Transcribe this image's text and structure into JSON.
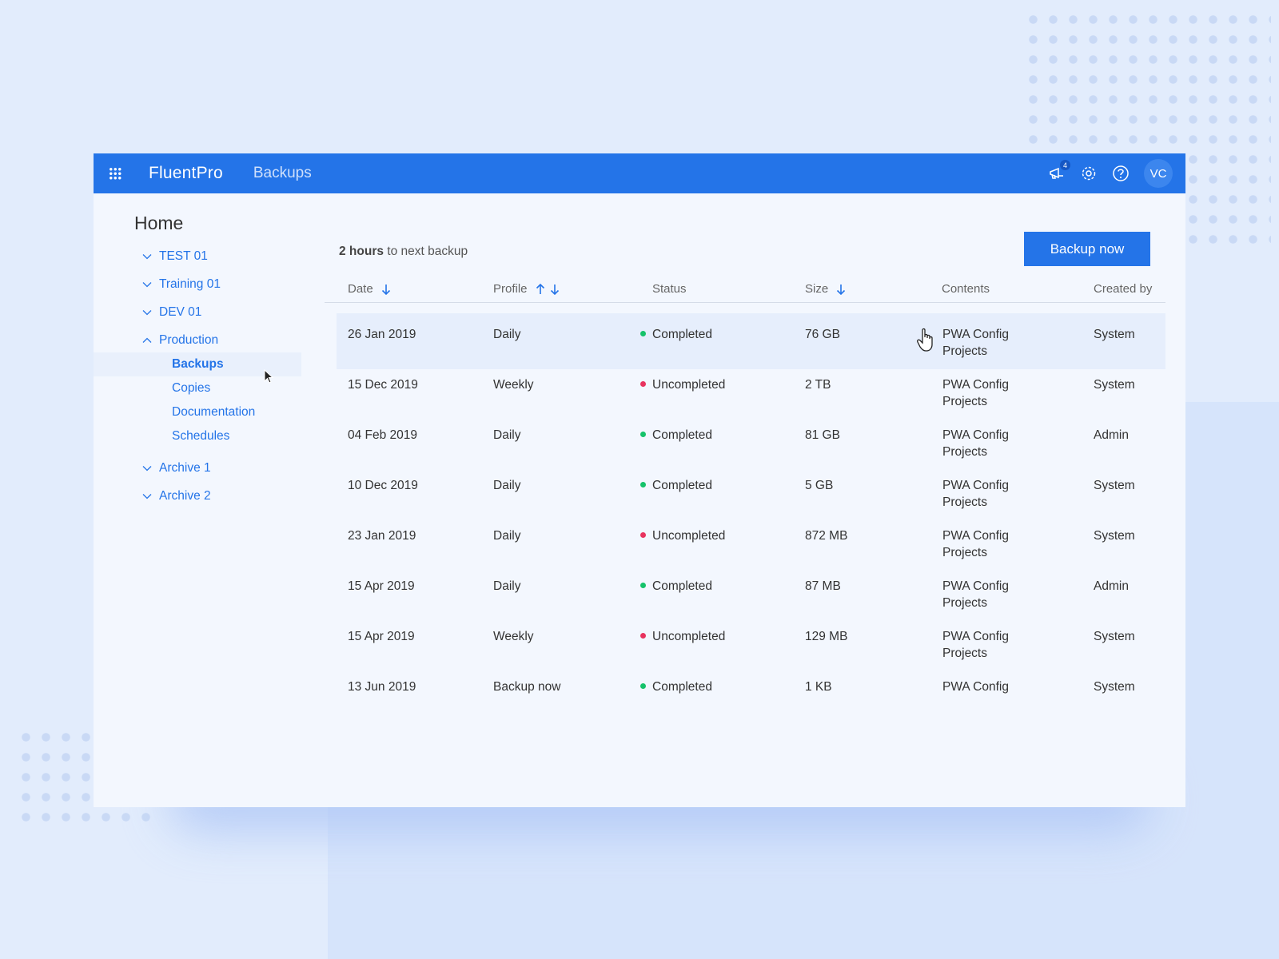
{
  "app": {
    "brand": "FluentPro",
    "section": "Backups"
  },
  "header": {
    "notifications_count": "4",
    "avatar_initials": "VC",
    "icons": [
      "grid-icon",
      "megaphone-icon",
      "gear-icon",
      "help-icon"
    ]
  },
  "sidebar": {
    "home": "Home",
    "items": [
      {
        "label": "TEST 01",
        "expanded": false
      },
      {
        "label": "Training 01",
        "expanded": false
      },
      {
        "label": "DEV 01",
        "expanded": false
      },
      {
        "label": "Production",
        "expanded": true
      }
    ],
    "sub_items": [
      {
        "label": "Backups",
        "active": true
      },
      {
        "label": "Copies"
      },
      {
        "label": "Documentation"
      },
      {
        "label": "Schedules"
      }
    ],
    "items_after": [
      {
        "label": "Archive 1"
      },
      {
        "label": "Archive 2"
      }
    ]
  },
  "main": {
    "next_backup_bold": "2 hours",
    "next_backup_rest": " to next backup",
    "backup_button": "Backup now",
    "columns": {
      "date": "Date",
      "profile": "Profile",
      "status": "Status",
      "size": "Size",
      "contents": "Contents",
      "created_by": "Created by"
    },
    "rows": [
      {
        "date": "26 Jan 2019",
        "profile": "Daily",
        "status": "Completed",
        "ok": true,
        "size": "76 GB",
        "contents": "PWA Config Projects",
        "created_by": "System"
      },
      {
        "date": "15 Dec 2019",
        "profile": "Weekly",
        "status": "Uncompleted",
        "ok": false,
        "size": "2 TB",
        "contents": "PWA Config Projects",
        "created_by": "System"
      },
      {
        "date": "04 Feb 2019",
        "profile": "Daily",
        "status": "Completed",
        "ok": true,
        "size": "81 GB",
        "contents": "PWA Config Projects",
        "created_by": "Admin"
      },
      {
        "date": "10 Dec 2019",
        "profile": "Daily",
        "status": "Completed",
        "ok": true,
        "size": "5 GB",
        "contents": "PWA Config Projects",
        "created_by": "System"
      },
      {
        "date": "23 Jan 2019",
        "profile": "Daily",
        "status": "Uncompleted",
        "ok": false,
        "size": "872 MB",
        "contents": "PWA Config Projects",
        "created_by": "System"
      },
      {
        "date": "15 Apr 2019",
        "profile": "Daily",
        "status": "Completed",
        "ok": true,
        "size": "87 MB",
        "contents": "PWA Config Projects",
        "created_by": "Admin"
      },
      {
        "date": "15 Apr 2019",
        "profile": "Weekly",
        "status": "Uncompleted",
        "ok": false,
        "size": "129 MB",
        "contents": "PWA Config Projects",
        "created_by": "System"
      },
      {
        "date": "13 Jun 2019",
        "profile": "Backup now",
        "status": "Completed",
        "ok": true,
        "size": "1 KB",
        "contents": "PWA Config",
        "created_by": "System"
      }
    ]
  },
  "colors": {
    "primary": "#2474e8",
    "ok": "#15c26a",
    "error": "#e8335e"
  }
}
